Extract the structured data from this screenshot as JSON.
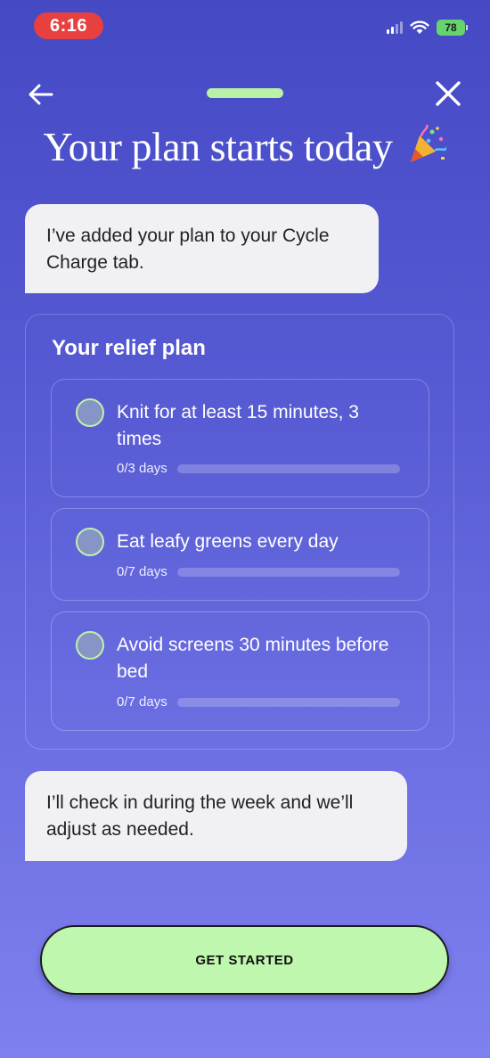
{
  "status_bar": {
    "time": "6:16",
    "battery": "78",
    "icons": [
      "signal-icon",
      "wifi-icon",
      "battery-icon"
    ]
  },
  "nav": {
    "back_icon": "arrow-left-icon",
    "close_icon": "close-icon"
  },
  "title": "Your plan starts today",
  "title_icon": "party-popper-icon",
  "messages": [
    "I’ve added your plan to your Cycle Charge tab.",
    "I’ll check in during the week and we’ll adjust as needed."
  ],
  "plan": {
    "title": "Your relief plan",
    "items": [
      {
        "text": "Knit for at least 15 minutes, 3 times",
        "progress_label": "0/3 days",
        "progress_fraction": 0
      },
      {
        "text": "Eat leafy greens every day",
        "progress_label": "0/7 days",
        "progress_fraction": 0
      },
      {
        "text": "Avoid screens 30 minutes before bed",
        "progress_label": "0/7 days",
        "progress_fraction": 0
      }
    ]
  },
  "cta_label": "GET STARTED",
  "colors": {
    "background_top": "#4549c4",
    "background_bottom": "#7f80ef",
    "accent_green": "#c0f7ae",
    "time_pill": "#e8403f",
    "bubble": "#f1f1f4"
  }
}
